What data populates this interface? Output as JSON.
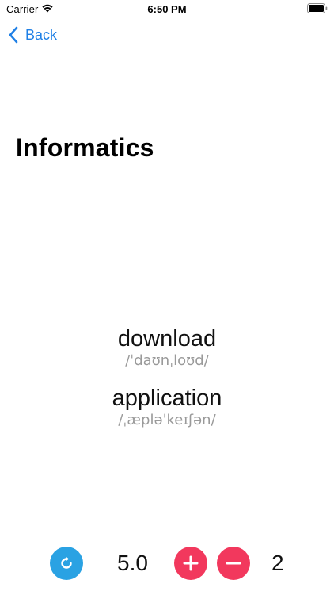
{
  "status_bar": {
    "carrier": "Carrier",
    "time": "6:50 PM"
  },
  "nav": {
    "back_label": "Back"
  },
  "title": "Informatics",
  "words": [
    {
      "word": "download",
      "ipa": "/ˈdaʊnˌloʊd/"
    },
    {
      "word": "application",
      "ipa": "/ˌæpləˈkeɪʃən/"
    }
  ],
  "controls": {
    "speed": "5.0",
    "count": "2"
  },
  "colors": {
    "accent_blue": "#1f80e6",
    "refresh_blue": "#2aa2e3",
    "action_red": "#f2385d",
    "ipa_gray": "#9a9a9a"
  },
  "icons": {
    "refresh": "refresh-icon",
    "plus": "plus-icon",
    "minus": "minus-icon",
    "back": "chevron-left-icon"
  }
}
